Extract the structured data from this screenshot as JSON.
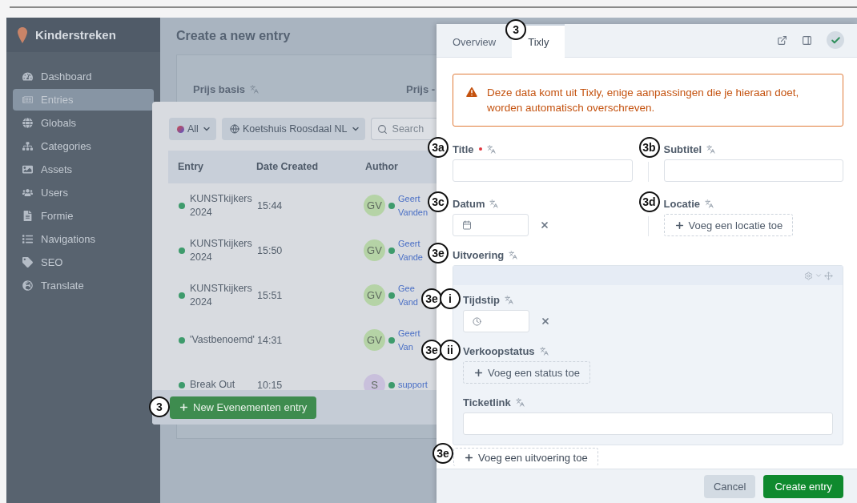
{
  "app": {
    "name": "Kinderstreken"
  },
  "sidebar": {
    "items": [
      {
        "label": "Dashboard",
        "selected": false
      },
      {
        "label": "Entries",
        "selected": true
      },
      {
        "label": "Globals",
        "selected": false
      },
      {
        "label": "Categories",
        "selected": false
      },
      {
        "label": "Assets",
        "selected": false
      },
      {
        "label": "Users",
        "selected": false
      },
      {
        "label": "Formie",
        "selected": false
      },
      {
        "label": "Navigations",
        "selected": false
      },
      {
        "label": "SEO",
        "selected": false
      },
      {
        "label": "Translate",
        "selected": false
      }
    ]
  },
  "page": {
    "title": "Create a new entry",
    "fields": [
      {
        "label": "Prijs basis"
      },
      {
        "label": "Prijs -"
      }
    ]
  },
  "entry_picker": {
    "filters": [
      {
        "kind": "status",
        "label": "All"
      },
      {
        "kind": "site",
        "label": "Koetshuis Roosdaal NL"
      }
    ],
    "search": {
      "placeholder": "Search"
    },
    "columns": [
      "Entry",
      "Date Created",
      "Author"
    ],
    "rows": [
      {
        "title": "KUNSTkijkers 2024",
        "created": "15:44",
        "initials": "GV",
        "color": "#b5d3a6",
        "author": "Geert Vanden"
      },
      {
        "title": "KUNSTkijkers 2024",
        "created": "15:50",
        "initials": "GV",
        "color": "#b5d3a6",
        "author": "Geert Vande"
      },
      {
        "title": "KUNSTkijkers 2024",
        "created": "15:51",
        "initials": "GV",
        "color": "#b5d3a6",
        "author": "Gee Vand"
      },
      {
        "title": "'Vastbenoemd'",
        "created": "14:31",
        "initials": "GV",
        "color": "#b5d3a6",
        "author": "Geert Van"
      },
      {
        "title": "Break Out",
        "created": "10:15",
        "initials": "S",
        "color": "#c9c0dc",
        "author": "support"
      }
    ],
    "new_button": {
      "label": "New Evenementen entry",
      "marker": "3"
    }
  },
  "panel": {
    "tabs": [
      {
        "label": "Overview",
        "selected": false
      },
      {
        "label": "Tixly",
        "selected": true,
        "marker": "3"
      }
    ],
    "alert": "Deze data komt uit Tixly, enige aanpassingen die je hieraan doet, worden automatisch overschreven.",
    "fields": [
      {
        "kind": "text",
        "label": "Title",
        "required": true,
        "marker": "3a"
      },
      {
        "kind": "text",
        "label": "Subtitel",
        "required": false,
        "marker": "3b"
      },
      {
        "kind": "date",
        "label": "Datum",
        "required": false,
        "marker": "3c"
      },
      {
        "kind": "relation",
        "label": "Locatie",
        "required": false,
        "marker": "3d",
        "button": "Voeg een locatie toe"
      }
    ],
    "uitvoering": {
      "label": "Uitvoering",
      "marker": "3e",
      "fields": [
        {
          "kind": "time",
          "label": "Tijdstip",
          "marker": "3e",
          "sub_marker": "i"
        },
        {
          "kind": "relation",
          "label": "Verkoopstatus",
          "marker": "3e",
          "sub_marker": "ii",
          "button": "Voeg een status toe"
        },
        {
          "kind": "text",
          "label": "Ticketlink"
        }
      ],
      "add_button": {
        "label": "Voeg een uitvoering toe",
        "marker": "3e"
      }
    },
    "buttons": [
      {
        "kind": "secondary",
        "label": "Cancel"
      },
      {
        "kind": "primary",
        "label": "Create entry"
      }
    ]
  }
}
